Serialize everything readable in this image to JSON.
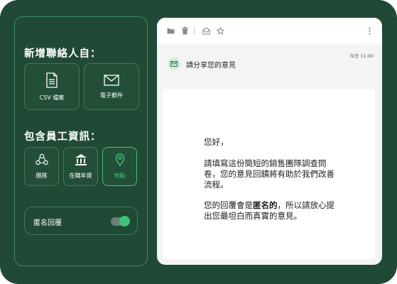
{
  "left": {
    "add_contacts_title": "新增聯絡人自：",
    "sources": [
      {
        "label": "CSV 檔案",
        "icon": "csv-file-icon"
      },
      {
        "label": "電子郵件",
        "icon": "envelope-icon"
      }
    ],
    "include_info_title": "包含員工資訊：",
    "fields": [
      {
        "label": "團隊",
        "icon": "team-icon",
        "selected": false
      },
      {
        "label": "在職年資",
        "icon": "bank-icon",
        "selected": false
      },
      {
        "label": "地點",
        "icon": "location-pin-icon",
        "selected": true
      }
    ],
    "anonymous_label": "匿名回覆",
    "anonymous_on": true
  },
  "mail": {
    "time": "今日 11:00",
    "subject": "請分享您的意見",
    "greeting": "您好，",
    "para1_line1": "請填寫這份簡短的銷售團隊調查問",
    "para1_line2": "卷，您的意見回饋將有助於我們改善",
    "para1_line3": "流程。",
    "para2_prefix": "您的回覆會是",
    "para2_bold": "匿名的",
    "para2_suffix": "，所以請放心提",
    "para2_line2": "出您最坦白而真實的意見。"
  },
  "colors": {
    "background": "#204a35",
    "accent": "#43c179",
    "card_border": "#3f7a5a"
  }
}
